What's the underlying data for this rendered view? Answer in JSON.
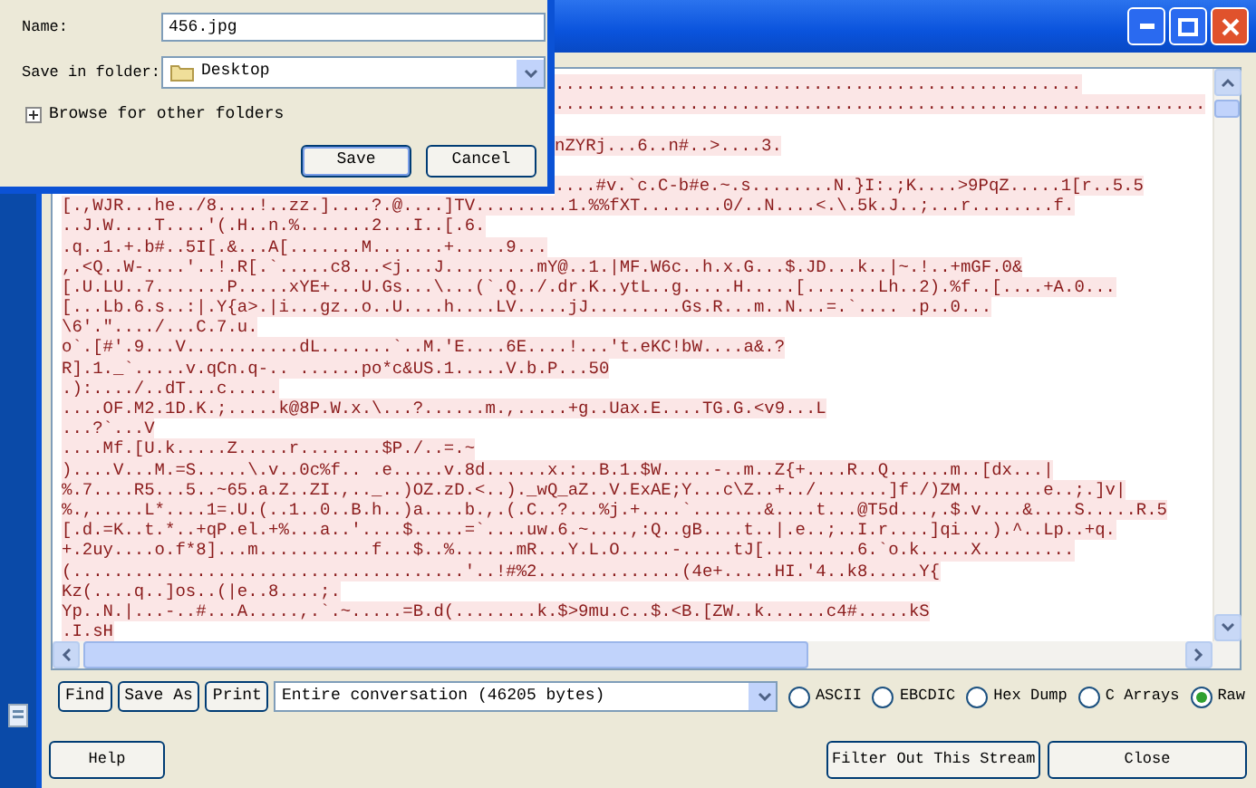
{
  "dialog": {
    "name_label": "Name:",
    "name_value": "456.jpg",
    "folder_label": "Save in folder:",
    "folder_value": "Desktop",
    "browse_label": "Browse for other folders",
    "expanded": false,
    "buttons": [
      "Save",
      "Cancel"
    ]
  },
  "stream": {
    "lines": [
      {
        "text": "...................................................",
        "covered": true,
        "blank_before": false
      },
      {
        "text": "...............................................................",
        "covered": true,
        "blank_before": false
      },
      {
        "text": "nZYRj...6..n#..>....3.",
        "covered": true,
        "blank_before": true
      },
      {
        "text": "....#v.`c.C-b#e.~.s........N.}I:.;K....>9PqZ.....1[r..5.5",
        "covered": true,
        "blank_before": true
      },
      {
        "text": "[.,WJR...he../8....!..zz.]....?.@....]TV.........1.%%fXT........0/..N....<.\\.5k.J..;...r........f.",
        "covered": false,
        "blank_before": false
      },
      {
        "text": "..J.W....T....'(.H..n.%.......2...I..[.6.",
        "covered": false,
        "blank_before": false
      },
      {
        "text": ".q..1.+.b#..5I[.&...A[.......M.......+.....9...",
        "covered": false,
        "blank_before": false
      },
      {
        "text": ",.<Q..W-....'..!.R[.`.....c8...<j...J.........mY@..1.|MF.W6c..h.x.G...$.JD...k..|~.!..+mGF.0&",
        "covered": false,
        "blank_before": false
      },
      {
        "text": "[.U.LU..7.......P.....xYE+...U.Gs...\\...(`.Q../.dr.K..ytL..g.....H.....[.......Lh..2).%f..[....+A.0...",
        "covered": false,
        "blank_before": false
      },
      {
        "text": "[...Lb.6.s..:|.Y{a>.|i...gz..o..U....h....LV.....jJ.........Gs.R...m..N...=.`.... .p..0...",
        "covered": false,
        "blank_before": false
      },
      {
        "text": "\\6'.\"..../...C.7.u.",
        "covered": false,
        "blank_before": false
      },
      {
        "text": "o`.[#'.9...V...........dL.......`..M.'E....6E....!...'t.eKC!bW....a&.?",
        "covered": false,
        "blank_before": false
      },
      {
        "text": "R].1._`.....v.qCn.q-.. ......po*c&US.1.....V.b.P...50",
        "covered": false,
        "blank_before": false
      },
      {
        "text": ".):..../..dT...c.....",
        "covered": false,
        "blank_before": false
      },
      {
        "text": "....OF.M2.1D.K.;.....k@8P.W.x.\\...?......m.,.....+g..Uax.E....TG.G.<v9...L",
        "covered": false,
        "blank_before": false
      },
      {
        "text": "...?`...V",
        "covered": false,
        "blank_before": false
      },
      {
        "text": "....Mf.[U.k.....Z.....r........$P./..=.~",
        "covered": false,
        "blank_before": false
      },
      {
        "text": ")....V...M.=S.....\\.v..0c%f.. .e.....v.8d......x.:..B.1.$W.....-..m..Z{+....R..Q......m..[dx...|",
        "covered": false,
        "blank_before": false
      },
      {
        "text": "%.7....R5...5..~65.a.Z..ZI.,.._..)OZ.zD.<..)._wQ_aZ..V.ExAE;Y...c\\Z..+../.......]f./)ZM........e..;.]v|",
        "covered": false,
        "blank_before": false
      },
      {
        "text": "%.,.....L*....1=.U.(..1..0..B.h..)a....b.,.(.C..?...%j.+....`.......&....t...@T5d...,.$.v....&....S.....R.5",
        "covered": false,
        "blank_before": false
      },
      {
        "text": "[.d.=K..t.*..+qP.el.+%...a..'....$.....=`....uw.6.~....,:Q..gB....t..|.e..;..I.r....]qi...).^..Lp..+q.",
        "covered": false,
        "blank_before": false
      },
      {
        "text": "+.2uy....o.f*8]...m...........f...$..%......mR...Y.L.O.....-.....tJ[.........6.`o.k.....X.........",
        "covered": false,
        "blank_before": false
      },
      {
        "text": "(......................................'..!#%2..............(4e+.....HI.'4..k8.....Y{",
        "covered": false,
        "blank_before": false
      },
      {
        "text": "Kz(....q..]os..(|e..8....;.",
        "covered": false,
        "blank_before": false
      },
      {
        "text": "Yp..N.|...-..#...A.....,.`.~.....=B.d(........k.$>9mu.c..$.<B.[ZW..k......c4#.....kS",
        "covered": false,
        "blank_before": false
      },
      {
        "text": ".I.sH",
        "covered": false,
        "blank_before": false
      }
    ]
  },
  "toolbar": {
    "buttons": [
      "Find",
      "Save As",
      "Print"
    ],
    "conversation": "Entire conversation (46205 bytes)",
    "formats": [
      {
        "label": "ASCII",
        "selected": false
      },
      {
        "label": "EBCDIC",
        "selected": false
      },
      {
        "label": "Hex Dump",
        "selected": false
      },
      {
        "label": "C Arrays",
        "selected": false
      },
      {
        "label": "Raw",
        "selected": true
      }
    ]
  },
  "footer": {
    "left_buttons": [
      "Help"
    ],
    "right_buttons": [
      "Filter Out This Stream",
      "Close"
    ]
  }
}
